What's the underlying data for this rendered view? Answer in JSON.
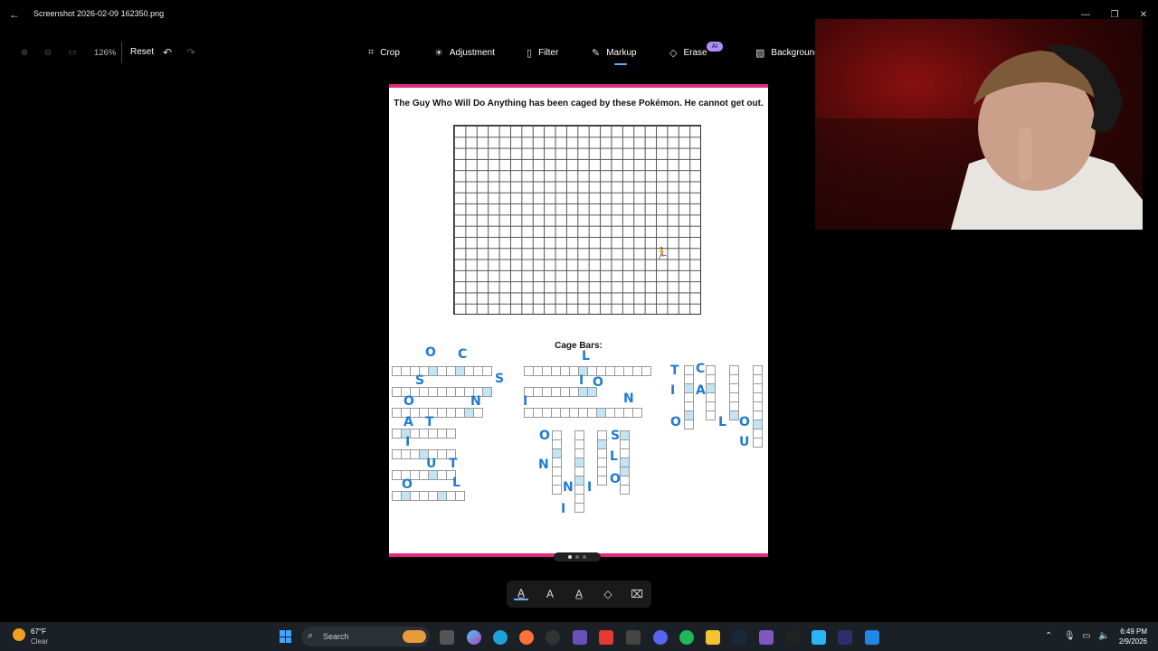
{
  "window": {
    "title": "Screenshot 2026-02-09 162350.png"
  },
  "toolbar": {
    "zoom_level": "126%",
    "reset_label": "Reset",
    "tools": [
      {
        "label": "Crop",
        "icon": "crop-icon"
      },
      {
        "label": "Adjustment",
        "icon": "brightness-icon"
      },
      {
        "label": "Filter",
        "icon": "filter-icon"
      },
      {
        "label": "Markup",
        "icon": "pen-icon",
        "active": true
      },
      {
        "label": "Erase",
        "icon": "eraser-icon",
        "badge": "AI"
      },
      {
        "label": "Background",
        "icon": "background-icon"
      }
    ],
    "accent_color": "#5ab0ff"
  },
  "document": {
    "heading": "The Guy Who Will Do Anything has been caged by these Pokémon. He cannot get out.",
    "cage_title": "Cage Bars:",
    "accent_color": "#e02a7e",
    "highlight_color": "#c3e4f3",
    "handwriting_color": "#1f7bd3",
    "handwritten_letters": {
      "top_left": [
        "O",
        "C",
        "S",
        "S",
        "O",
        "N",
        "A",
        "T",
        "I",
        "U",
        "T",
        "O",
        "L"
      ],
      "top_middle": [
        "L",
        "I",
        "O",
        "I",
        "N"
      ],
      "bottom_middle": [
        "O",
        "N",
        "S",
        "L",
        "O",
        "N",
        "I",
        "I"
      ],
      "right": [
        "T",
        "C",
        "I",
        "A",
        "O",
        "L",
        "O",
        "U"
      ]
    }
  },
  "markup_tools": [
    {
      "icon": "ballpoint-pen-icon",
      "active": true
    },
    {
      "icon": "pencil-icon"
    },
    {
      "icon": "highlighter-icon"
    },
    {
      "icon": "eraser-icon"
    },
    {
      "icon": "clear-markup-icon"
    }
  ],
  "taskbar": {
    "weather_temp": "67°F",
    "weather_cond": "Clear",
    "search_placeholder": "Search",
    "time": "6:49 PM",
    "date": "2/9/2026"
  }
}
